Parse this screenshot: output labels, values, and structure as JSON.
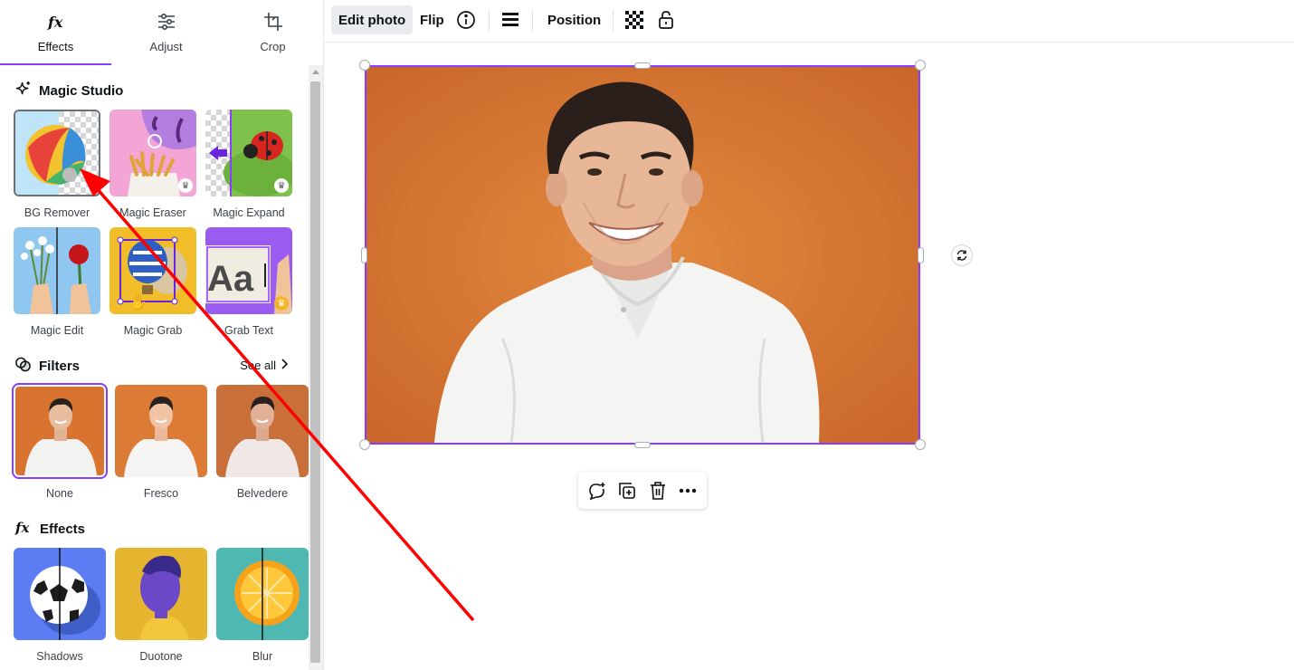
{
  "tabs": [
    {
      "label": "Effects",
      "icon": "fx-icon"
    },
    {
      "label": "Adjust",
      "icon": "sliders-icon"
    },
    {
      "label": "Crop",
      "icon": "crop-icon"
    }
  ],
  "magic_studio": {
    "title": "Magic Studio",
    "items": [
      {
        "label": "BG Remover"
      },
      {
        "label": "Magic Eraser",
        "premium": true
      },
      {
        "label": "Magic Expand",
        "premium": true
      },
      {
        "label": "Magic Edit"
      },
      {
        "label": "Magic Grab"
      },
      {
        "label": "Grab Text",
        "premium": true
      }
    ]
  },
  "filters": {
    "title": "Filters",
    "see_all": "See all",
    "items": [
      {
        "label": "None",
        "selected": true
      },
      {
        "label": "Fresco"
      },
      {
        "label": "Belvedere"
      }
    ]
  },
  "effects": {
    "title": "Effects",
    "items": [
      {
        "label": "Shadows"
      },
      {
        "label": "Duotone"
      },
      {
        "label": "Blur"
      }
    ]
  },
  "toolbar": {
    "edit_photo": "Edit photo",
    "flip": "Flip",
    "position": "Position"
  },
  "colors": {
    "accent": "#8b3dff",
    "photo_bg": "#d8742f",
    "annotation": "#ff0000"
  }
}
